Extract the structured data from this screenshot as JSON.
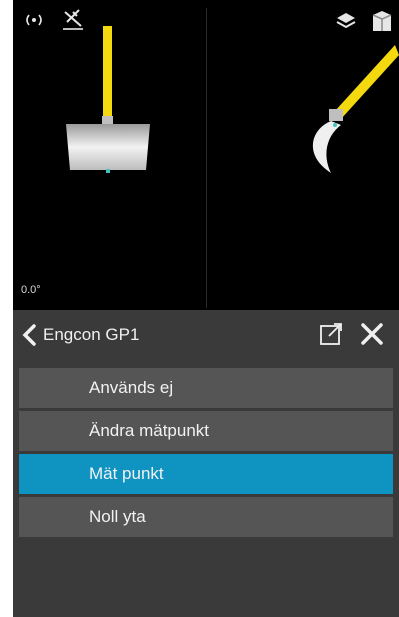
{
  "view": {
    "angle": "0.0°",
    "icons": [
      "radio-signal-icon",
      "gps-off-icon",
      "layers-icon",
      "cube-icon"
    ]
  },
  "header": {
    "title": "Engcon GP1"
  },
  "menu": {
    "items": [
      {
        "label": "Används ej",
        "selected": false
      },
      {
        "label": "Ändra mätpunkt",
        "selected": false
      },
      {
        "label": "Mät punkt",
        "selected": true
      },
      {
        "label": "Noll yta",
        "selected": false
      }
    ]
  },
  "colors": {
    "selected": "#0f94c2",
    "arm": "#f5d90f",
    "panel": "#3a3a3a",
    "item": "#555555"
  }
}
